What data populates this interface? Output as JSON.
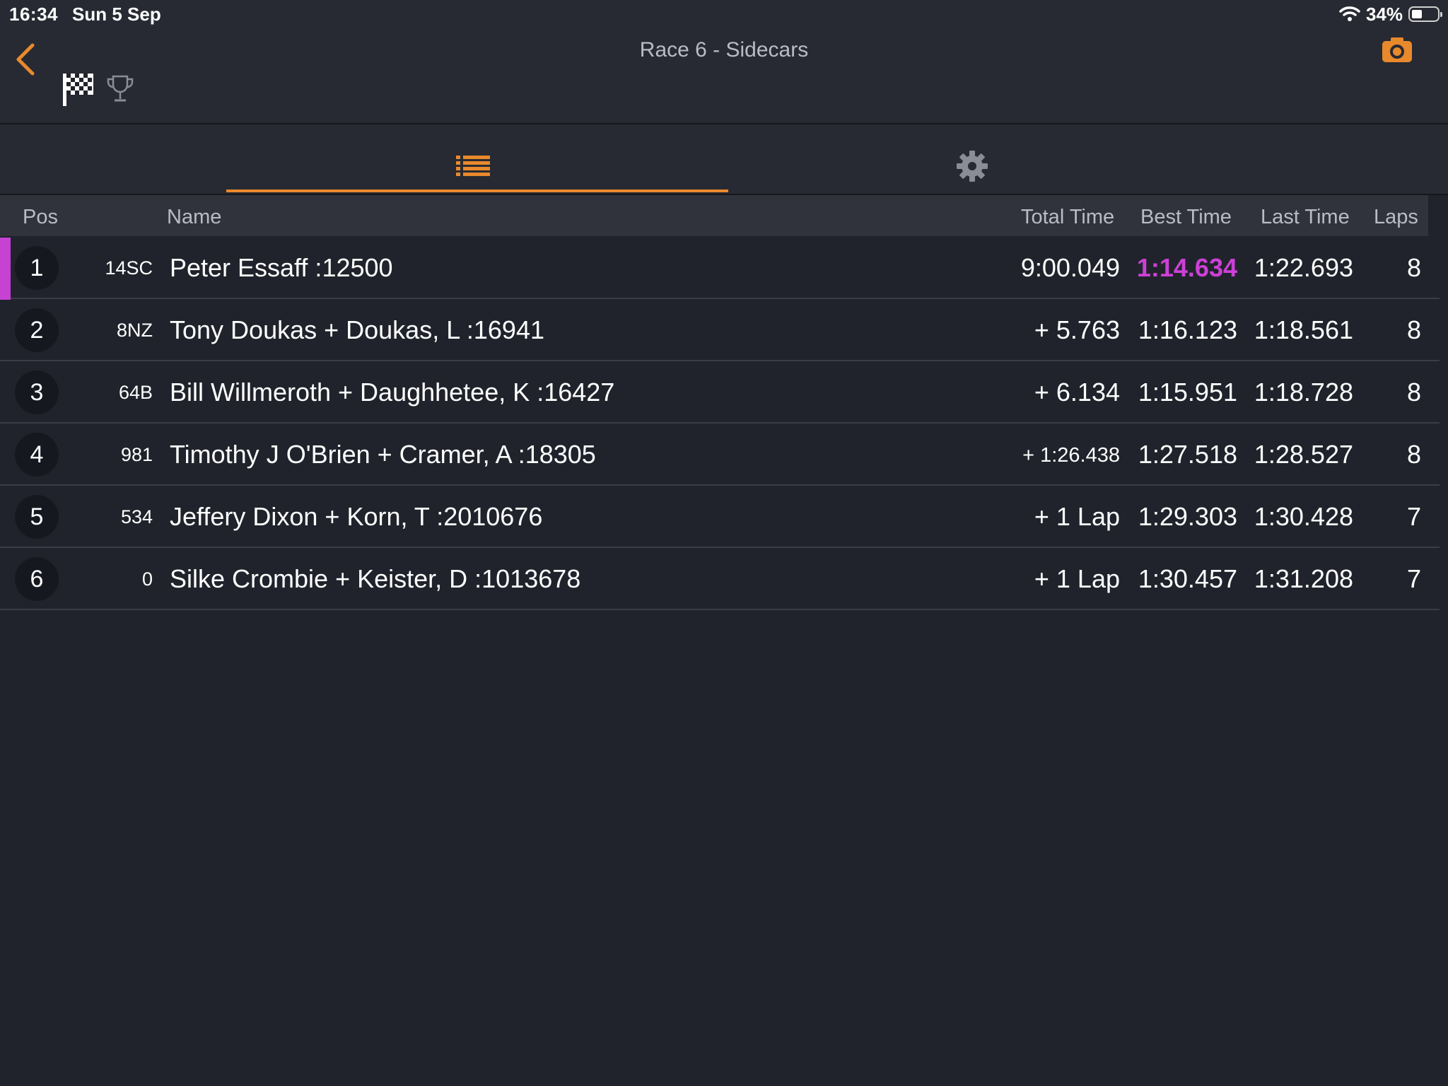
{
  "status_bar": {
    "time": "16:34",
    "date": "Sun 5 Sep",
    "battery": "34%",
    "battery_level": 0.34
  },
  "header": {
    "title": "Race 6 - Sidecars",
    "accent_color": "#e8892c"
  },
  "icons": {
    "back": "chevron-left-icon",
    "flag": "checkered-flag-icon",
    "trophy": "trophy-icon",
    "camera": "camera-icon",
    "list": "list-icon",
    "settings": "gear-icon"
  },
  "table": {
    "columns": {
      "pos": "Pos",
      "name": "Name",
      "total": "Total Time",
      "best": "Best Time",
      "last": "Last Time",
      "laps": "Laps"
    },
    "fastest_color": "#cc40d6",
    "rows": [
      {
        "pos": "1",
        "num": "14SC",
        "name": "Peter Essaff :12500",
        "total": "9:00.049",
        "best": "1:14.634",
        "last": "1:22.693",
        "laps": "8"
      },
      {
        "pos": "2",
        "num": "8NZ",
        "name": "Tony Doukas + Doukas, L :16941",
        "total": "+ 5.763",
        "best": "1:16.123",
        "last": "1:18.561",
        "laps": "8"
      },
      {
        "pos": "3",
        "num": "64B",
        "name": "Bill Willmeroth + Daughhetee, K :16427",
        "total": "+ 6.134",
        "best": "1:15.951",
        "last": "1:18.728",
        "laps": "8"
      },
      {
        "pos": "4",
        "num": "981",
        "name": "Timothy J O'Brien + Cramer, A :18305",
        "total": "+ 1:26.438",
        "best": "1:27.518",
        "last": "1:28.527",
        "laps": "8"
      },
      {
        "pos": "5",
        "num": "534",
        "name": "Jeffery Dixon + Korn, T :2010676",
        "total": "+ 1 Lap",
        "best": "1:29.303",
        "last": "1:30.428",
        "laps": "7"
      },
      {
        "pos": "6",
        "num": "0",
        "name": "Silke Crombie + Keister, D :1013678",
        "total": "+ 1 Lap",
        "best": "1:30.457",
        "last": "1:31.208",
        "laps": "7"
      }
    ]
  }
}
